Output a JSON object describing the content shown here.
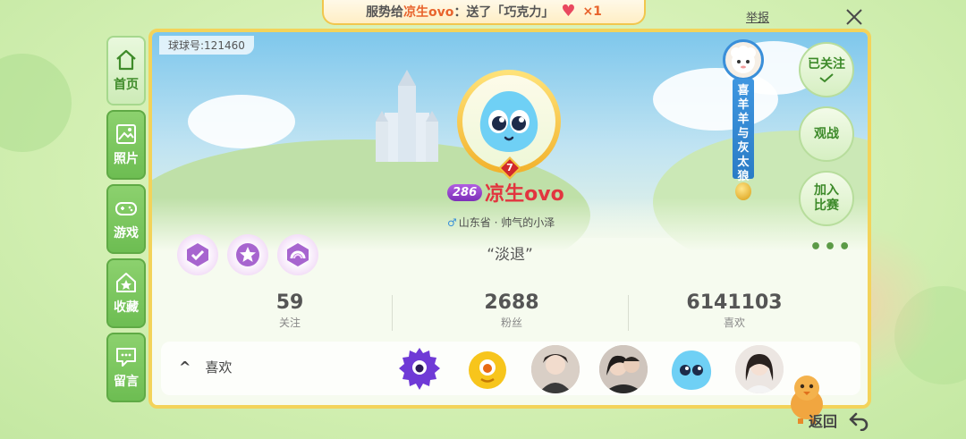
{
  "banner": {
    "prefix": "服势给",
    "name": "凉生ovo",
    "action": "：送了「巧克力」",
    "multiplier": "×1"
  },
  "header": {
    "report_label": "举报",
    "close_icon": "close-icon"
  },
  "sidebar": {
    "items": [
      {
        "label": "首页",
        "icon": "home-icon",
        "active": true
      },
      {
        "label": "照片",
        "icon": "photo-icon",
        "active": false
      },
      {
        "label": "游戏",
        "icon": "gamepad-icon",
        "active": false
      },
      {
        "label": "收藏",
        "icon": "star-house-icon",
        "active": false
      },
      {
        "label": "留言",
        "icon": "message-icon",
        "active": false
      }
    ]
  },
  "profile": {
    "ball_id": "球球号:121460",
    "rank_number": "7",
    "level": "286",
    "nickname": "凉生ovo",
    "gender_symbol": "♂",
    "location": "山东省 · 帅气的小泽",
    "signature": "“淡退”",
    "badges": [
      "check-badge",
      "star-badge",
      "rainbow-badge"
    ]
  },
  "stats": {
    "following": {
      "value": "59",
      "label": "关注"
    },
    "fans": {
      "value": "2688",
      "label": "粉丝"
    },
    "likes": {
      "value": "6141103",
      "label": "喜欢"
    }
  },
  "likes_panel": {
    "toggle_label": "喜欢",
    "chevron": "^"
  },
  "actions": {
    "followed": "已关注",
    "spectate": "观战",
    "join_match_1": "加入",
    "join_match_2": "比赛",
    "more": "•••"
  },
  "hanger": {
    "text": "喜羊羊与灰太狼"
  },
  "footer": {
    "back_label": "返回"
  },
  "colors": {
    "accent_green": "#6dbd52",
    "card_border": "#f3d35a",
    "nickname_red": "#e2353f",
    "level_purple": "#8a3bc4"
  }
}
